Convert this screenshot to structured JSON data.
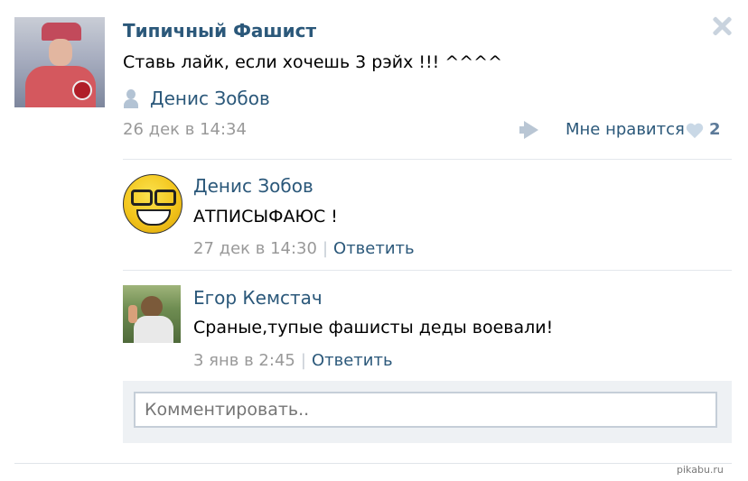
{
  "post": {
    "author": "Типичный Фашист",
    "text": "Ставь лайк, если хочешь 3 рэйх !!! ^^^^",
    "signer": "Денис Зобов",
    "date": "26 дек в 14:34",
    "like_label": "Мне нравится",
    "like_count": "2"
  },
  "comments": [
    {
      "name": "Денис Зобов",
      "text": "АТПИСЫФАЮС !",
      "date": "27 дек в 14:30",
      "separator": "|",
      "reply": "Ответить"
    },
    {
      "name": "Егор Кемстач",
      "text": "Сраные,тупые фашисты деды воевали!",
      "date": "3 янв в 2:45",
      "separator": "|",
      "reply": "Ответить"
    }
  ],
  "comment_box": {
    "placeholder": "Комментировать.."
  },
  "watermark": "pikabu.ru",
  "icons": {
    "close": "close-icon",
    "user": "user-icon",
    "share": "megaphone-icon",
    "heart": "heart-icon"
  },
  "colors": {
    "link": "#2b587a",
    "muted": "#999999",
    "icon": "#c9d3de"
  }
}
